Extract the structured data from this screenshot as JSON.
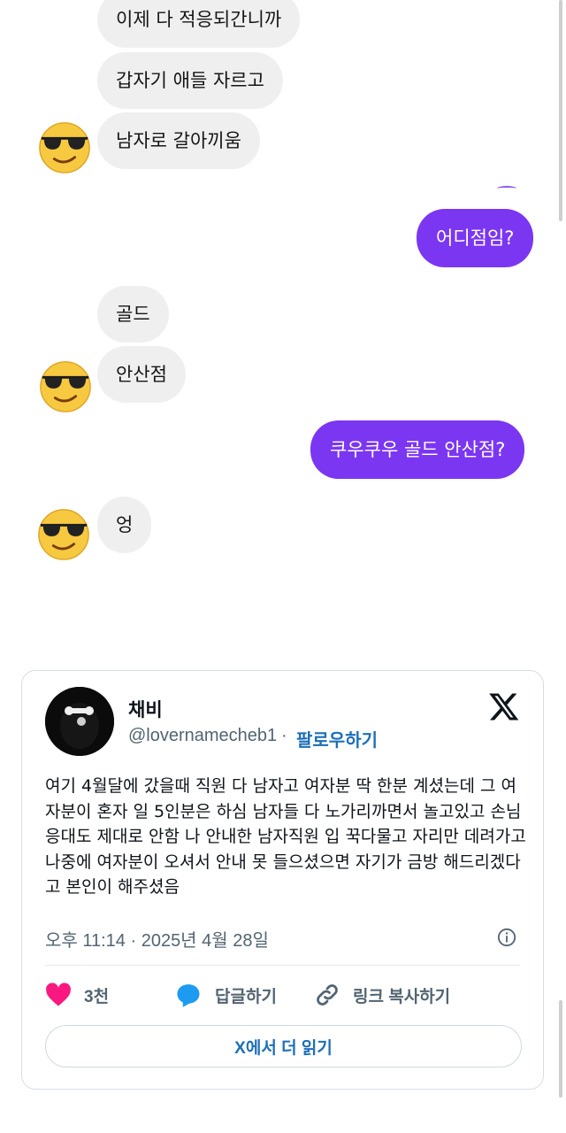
{
  "chat": {
    "messages": [
      {
        "side": "in",
        "text": "이제 다 적응되간니까"
      },
      {
        "side": "in",
        "text": "갑자기 애들 자르고"
      },
      {
        "side": "in",
        "text": "남자로 갈아끼움"
      },
      {
        "side": "out",
        "text": "어디점임?"
      },
      {
        "side": "in",
        "text": "골드"
      },
      {
        "side": "in",
        "text": "안산점"
      },
      {
        "side": "out",
        "text": "쿠우쿠우 골드 안산점?"
      },
      {
        "side": "in",
        "text": "엉"
      }
    ],
    "avatar_icon": "sunglasses-emoji-icon",
    "outgoing_color": "#7b36f2"
  },
  "tweet": {
    "author_name": "채비",
    "handle": "@lovernamecheb1",
    "separator": "·",
    "follow_label": "팔로우하기",
    "body": "여기 4월달에 갔을때 직원 다 남자고 여자분 딱 한분 계셨는데 그 여자분이 혼자 일 5인분은 하심 남자들 다 노가리까면서 놀고있고 손님 응대도 제대로 안함 나 안내한 남자직원 입 꾹다물고 자리만 데려가고 나중에 여자분이 오셔서 안내 못 들으셨으면 자기가 금방 해드리겠다고 본인이 해주셨음",
    "timestamp": "오후 11:14 · 2025년 4월 28일",
    "likes_label": "3천",
    "reply_label": "답글하기",
    "copy_link_label": "링크 복사하기",
    "read_more_label": "X에서 더 읽기",
    "accent_color": "#1d6fb8",
    "like_color": "#f91880"
  }
}
